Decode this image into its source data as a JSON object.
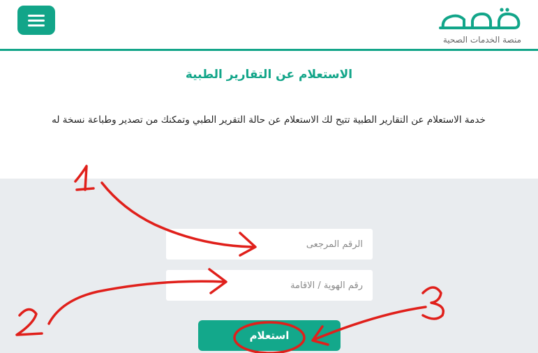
{
  "header": {
    "menu_icon": "hamburger-menu-icon",
    "logo_text": "صحة",
    "logo_subtitle": "منصة الخدمات الصحية",
    "accent_color": "#12a589"
  },
  "main": {
    "title": "الاستعلام عن التقارير الطبية",
    "description": "خدمة الاستعلام عن التقارير الطبية تتيح لك الاستعلام عن حالة التقرير الطبي وتمكنك من تصدير وطباعة نسخة له"
  },
  "form": {
    "reference_placeholder": "الرقم المرجعى",
    "id_placeholder": "رقم الهوية / الاقامة",
    "submit_label": "استعلام"
  },
  "annotations": {
    "labels": [
      "1",
      "2",
      "3"
    ],
    "color": "#e0201b"
  }
}
